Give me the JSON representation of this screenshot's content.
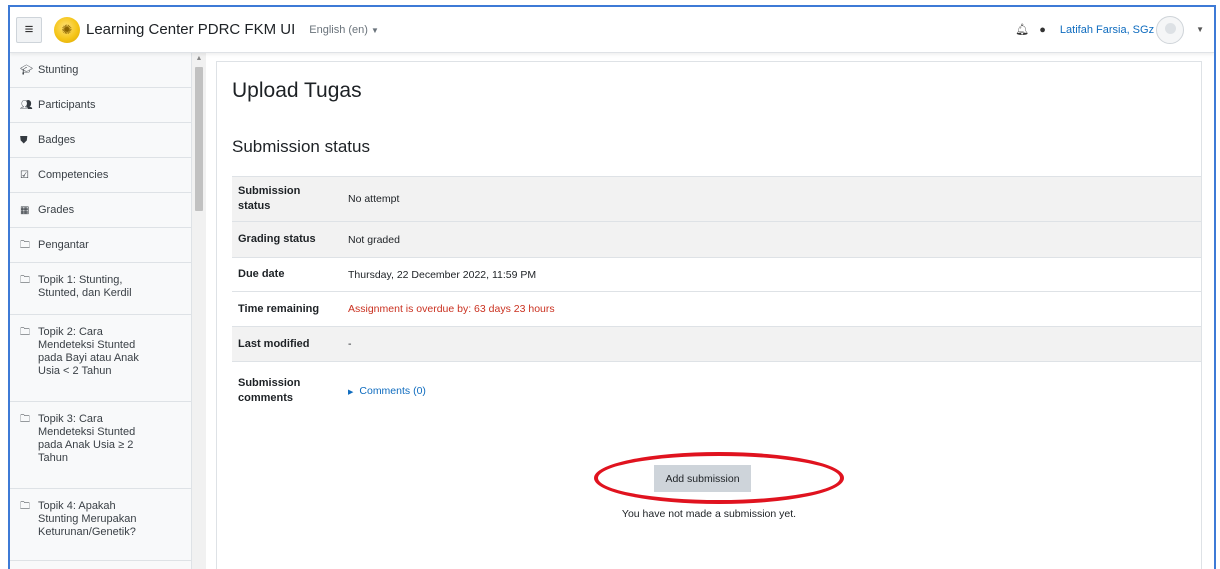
{
  "navbar": {
    "site_name": "Learning Center PDRC FKM UI",
    "language": "English (en)",
    "user_name": "Latifah Farsia, SGz",
    "icons": [
      "menu-icon",
      "bell-icon",
      "chat-icon"
    ]
  },
  "sidebar": {
    "items": [
      {
        "label": "Stunting",
        "icon": "graduation-cap-icon"
      },
      {
        "label": "Participants",
        "icon": "users-icon"
      },
      {
        "label": "Badges",
        "icon": "shield-icon"
      },
      {
        "label": "Competencies",
        "icon": "checkbox-icon"
      },
      {
        "label": "Grades",
        "icon": "table-icon"
      },
      {
        "label": "Pengantar",
        "icon": "folder-icon"
      },
      {
        "label": "Topik 1: Stunting,\nStunted, dan Kerdil",
        "icon": "folder-icon"
      },
      {
        "label": "Topik 2: Cara\nMendeteksi Stunted\npada Bayi atau Anak\nUsia < 2 Tahun",
        "icon": "folder-icon"
      },
      {
        "label": "Topik 3: Cara\nMendeteksi Stunted\npada Anak Usia ≥ 2\nTahun",
        "icon": "folder-icon"
      },
      {
        "label": "Topik 4: Apakah\nStunting Merupakan\nKeturunan/Genetik?",
        "icon": "folder-icon"
      }
    ]
  },
  "main": {
    "title": "Upload Tugas",
    "section_title": "Submission status",
    "rows": [
      {
        "label": "Submission status",
        "value": "No attempt"
      },
      {
        "label": "Grading status",
        "value": "Not graded"
      },
      {
        "label": "Due date",
        "value": "Thursday, 22 December 2022, 11:59 PM"
      },
      {
        "label": "Time remaining",
        "value": "Assignment is overdue by: 63 days 23 hours"
      },
      {
        "label": "Last modified",
        "value": "-"
      },
      {
        "label": "Submission comments",
        "value": "Comments (0)"
      }
    ],
    "add_submission_label": "Add submission",
    "note": "You have not made a submission yet."
  },
  "colors": {
    "frame": "#3d7ad6",
    "link": "#0f6cbf",
    "overdue": "#ca3120",
    "highlight": "#e0131f",
    "button": "#ced4da"
  }
}
